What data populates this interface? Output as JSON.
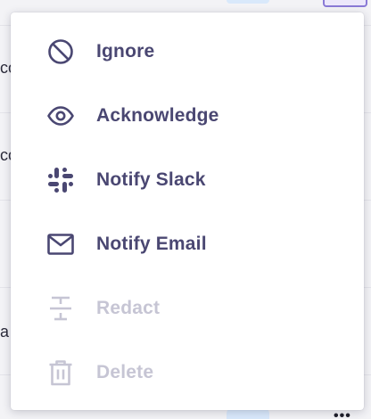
{
  "menu": {
    "items": [
      {
        "label": "Ignore",
        "icon": "block-icon",
        "enabled": true
      },
      {
        "label": "Acknowledge",
        "icon": "eye-icon",
        "enabled": true
      },
      {
        "label": "Notify Slack",
        "icon": "slack-icon",
        "enabled": true
      },
      {
        "label": "Notify Email",
        "icon": "mail-icon",
        "enabled": true
      },
      {
        "label": "Redact",
        "icon": "strikethrough-icon",
        "enabled": false
      },
      {
        "label": "Delete",
        "icon": "trash-icon",
        "enabled": false
      }
    ]
  },
  "background": {
    "fragments": [
      "co",
      "co",
      "a"
    ],
    "more_menu_glyph": "•••"
  },
  "colors": {
    "enabled": "#4a4772",
    "disabled": "#c6c5d4",
    "menu_bg": "#ffffff"
  }
}
